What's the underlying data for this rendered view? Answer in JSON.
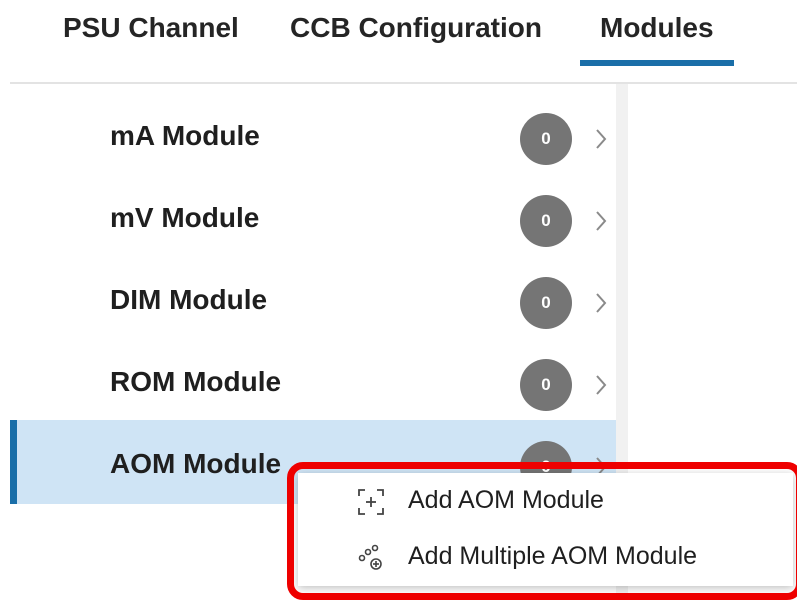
{
  "tabs": [
    {
      "label": "PSU Channel"
    },
    {
      "label": "CCB Configuration"
    },
    {
      "label": "Modules",
      "active": true
    }
  ],
  "modules": [
    {
      "label": "mA Module",
      "count": "0"
    },
    {
      "label": "mV Module",
      "count": "0"
    },
    {
      "label": "DIM Module",
      "count": "0"
    },
    {
      "label": "ROM Module",
      "count": "0"
    },
    {
      "label": "AOM Module",
      "count": "0",
      "selected": true
    }
  ],
  "context_menu": {
    "items": [
      {
        "label": "Add AOM Module",
        "icon": "add-frame-icon"
      },
      {
        "label": "Add Multiple AOM Module",
        "icon": "add-multiple-icon"
      }
    ]
  },
  "colors": {
    "accent": "#1a6ea8",
    "selected_row": "#cfe4f5",
    "badge": "#757575",
    "highlight": "#ee0000"
  }
}
